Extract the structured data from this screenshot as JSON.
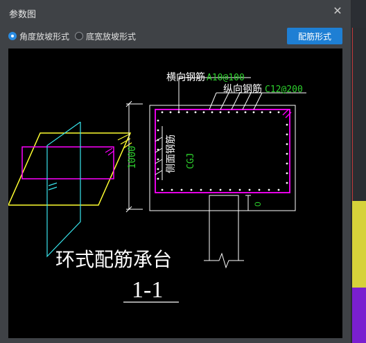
{
  "dialog": {
    "title": "参数图",
    "close_glyph": "✕"
  },
  "options": [
    {
      "label": "角度放坡形式",
      "selected": true
    },
    {
      "label": "底宽放坡形式",
      "selected": false
    }
  ],
  "actions": {
    "rebar_form_label": "配筋形式"
  },
  "drawing": {
    "transverse_label": "横向钢筋",
    "transverse_value": "A10@100",
    "longitudinal_label": "纵向钢筋",
    "longitudinal_value": "C12@200",
    "side_label": "侧面钢筋",
    "side_value": "CGJ",
    "dim_height": "1000",
    "dim_zero": "0",
    "caption": "环式配筋承台",
    "section": "1-1"
  },
  "colors": {
    "accent": "#1e7fd4",
    "magenta": "#ff00ff",
    "cyan": "#38e6ee",
    "yellow": "#ffff30",
    "green": "#2dd12d",
    "white": "#ffffff"
  }
}
